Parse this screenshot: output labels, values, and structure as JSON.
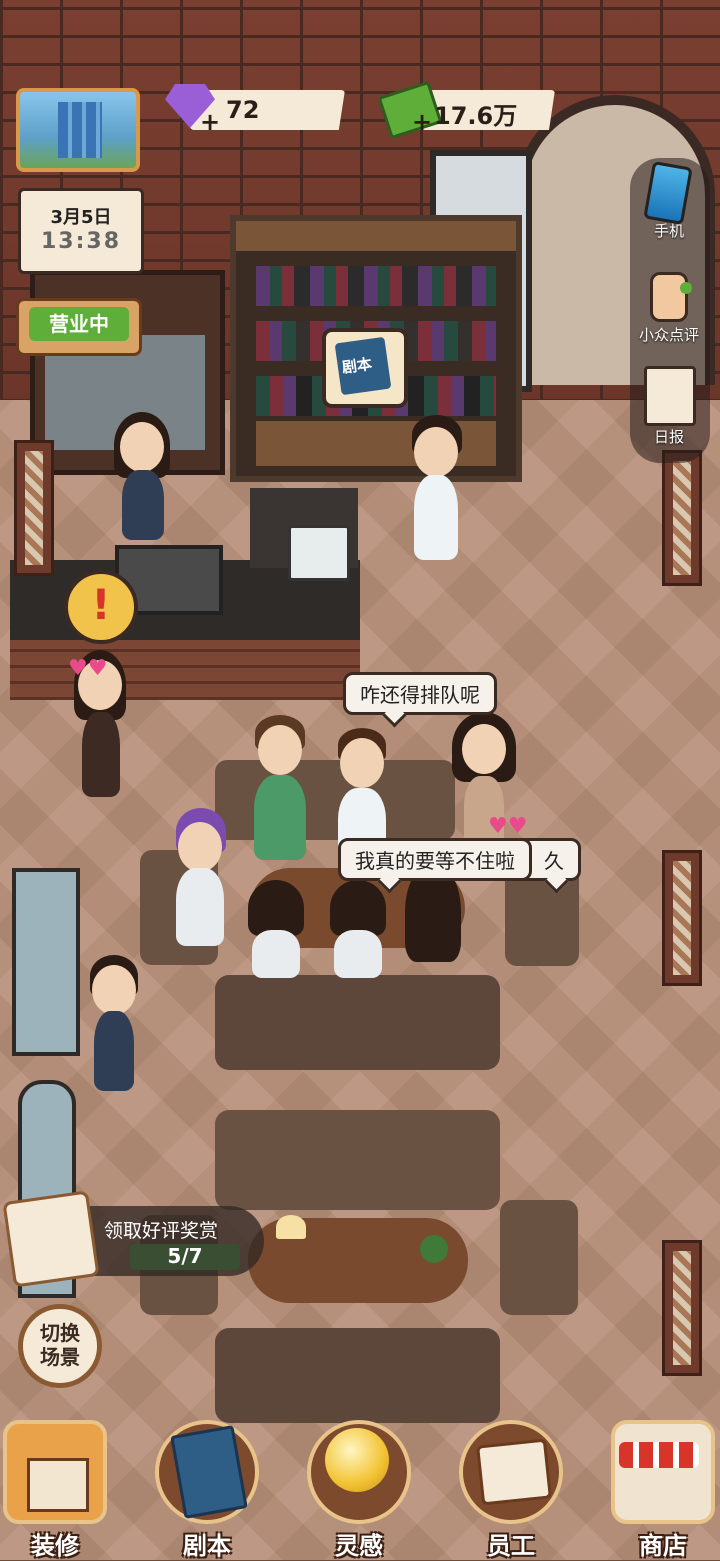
{
  "resources": {
    "gems": "72",
    "money": "17.6万"
  },
  "calendar": {
    "date": "3月5日",
    "time": "13:38"
  },
  "status_sign": "营业中",
  "shelf_badge": "剧本",
  "side_menu": {
    "phone": "手机",
    "review": "小众点评",
    "daily": "日报"
  },
  "bubbles": {
    "queue_complaint": "咋还得排队呢",
    "impatient": "我真的要等不住啦",
    "hidden_tail": "久"
  },
  "reward": {
    "label": "领取好评奖赏",
    "progress": "5/7"
  },
  "switch_scene": "切换\n场景",
  "bottom_nav": [
    {
      "label": "装修",
      "icon": "house-icon"
    },
    {
      "label": "剧本",
      "icon": "script-book-icon"
    },
    {
      "label": "灵感",
      "icon": "lightbulb-icon"
    },
    {
      "label": "员工",
      "icon": "id-badge-icon"
    },
    {
      "label": "商店",
      "icon": "shop-icon"
    }
  ],
  "colors": {
    "brick": "#6a3529",
    "floor": "#b78f78",
    "accent_green": "#5fae3a",
    "nav_ring": "#e8c48a"
  }
}
